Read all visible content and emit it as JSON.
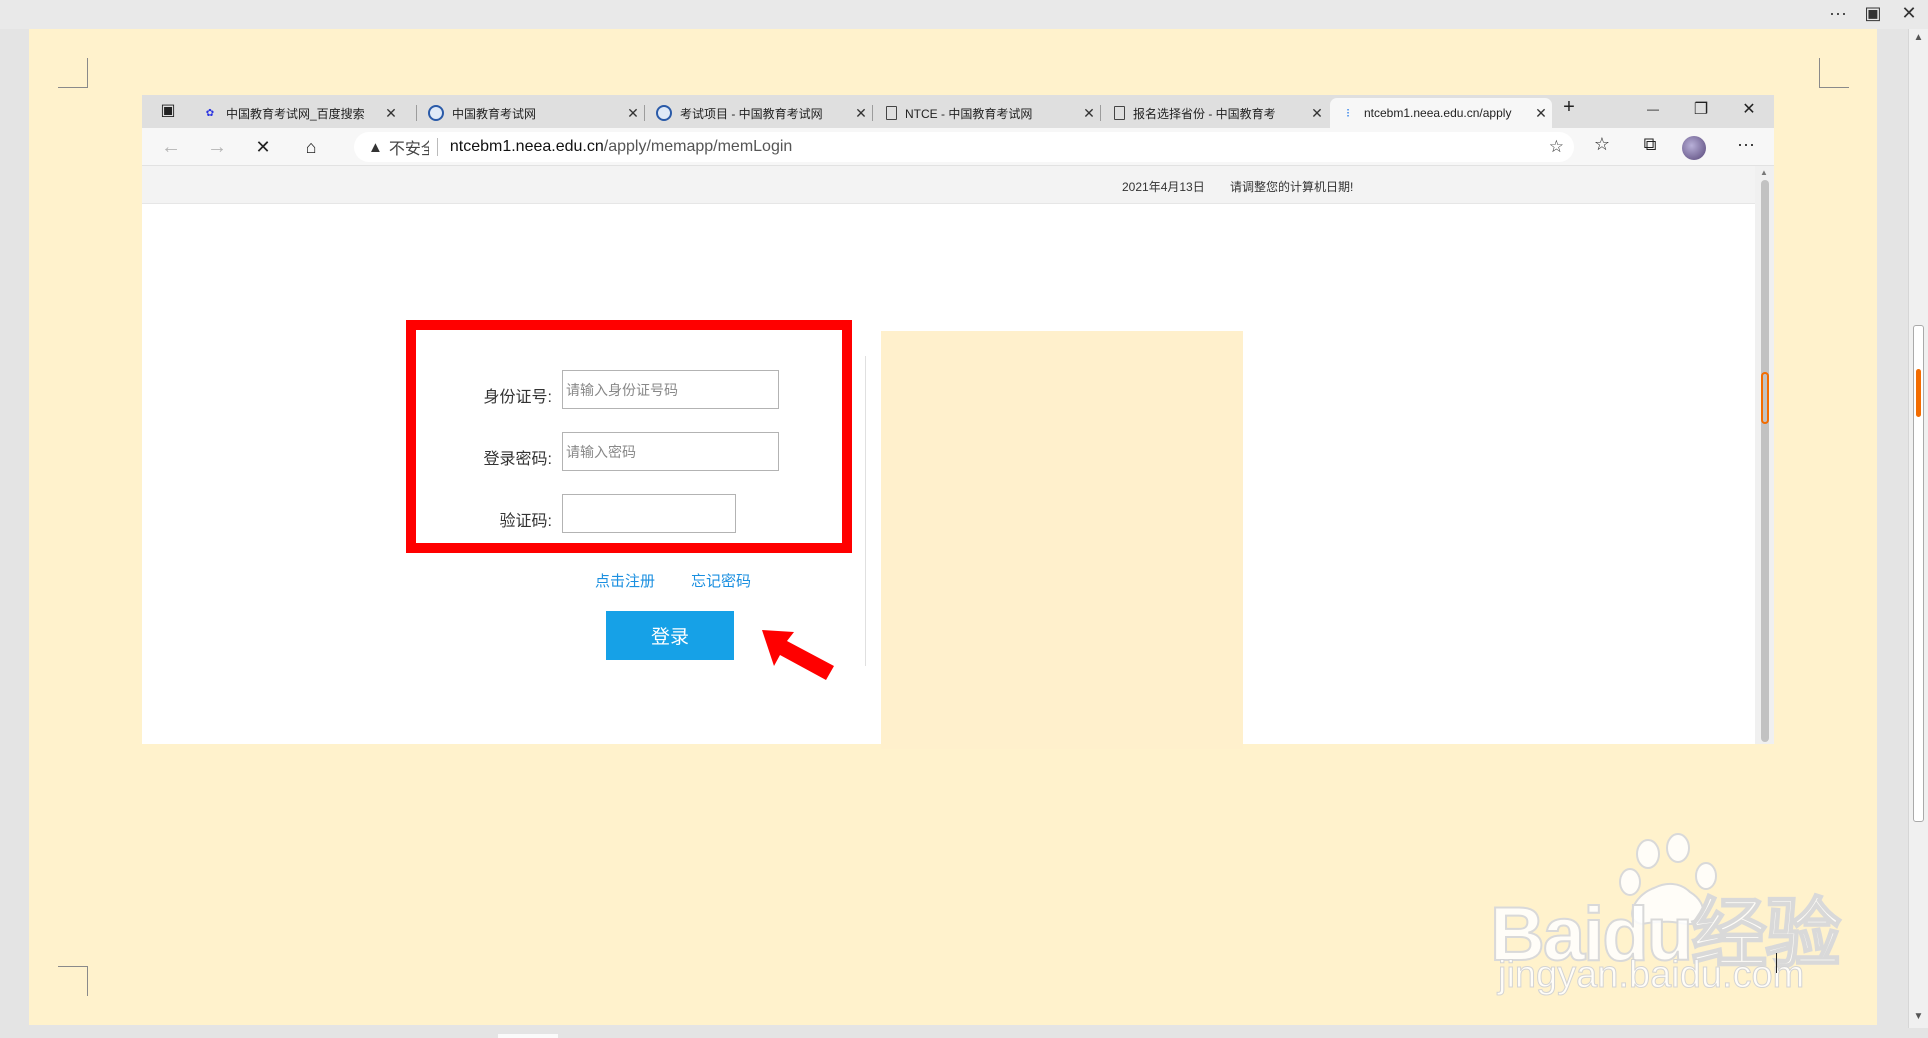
{
  "outer_window": {
    "more_label": "···",
    "restore_label": "▣",
    "close_label": "✕"
  },
  "browser": {
    "tabs": [
      {
        "title": "中国教育考试网_百度搜索",
        "icon": "baidu-paw-icon",
        "active": false
      },
      {
        "title": "中国教育考试网",
        "icon": "neea-globe-icon",
        "active": false
      },
      {
        "title": "考试项目 - 中国教育考试网",
        "icon": "neea-globe-icon",
        "active": false
      },
      {
        "title": "NTCE - 中国教育考试网",
        "icon": "page-icon",
        "active": false
      },
      {
        "title": "报名选择省份 - 中国教育考",
        "icon": "page-icon",
        "active": false
      },
      {
        "title": "ntcebm1.neea.edu.cn/apply",
        "icon": "loading-icon",
        "active": true
      }
    ],
    "tab_close": "✕",
    "new_tab": "+",
    "window_controls": {
      "minimize": "—",
      "maximize": "❐",
      "close": "✕"
    },
    "address": {
      "insecure_label": "不安全",
      "host": "ntcebm1.neea.edu.cn",
      "path": "/apply/memapp/memLogin"
    }
  },
  "page": {
    "date_text": "2021年4月13日",
    "date_notice": "请调整您的计算机日期!",
    "form": {
      "id_label": "身份证号:",
      "id_placeholder": "请输入身份证号码",
      "password_label": "登录密码:",
      "password_placeholder": "请输入密码",
      "captcha_label": "验证码:",
      "captcha_value": ""
    },
    "register_link": "点击注册",
    "forgot_link": "忘记密码",
    "login_button": "登录"
  },
  "annotation": {
    "box_color": "#ff0000",
    "arrow_color": "#ff0000"
  },
  "watermark": {
    "brand": "Baidu经验",
    "url": "jingyan.baidu.com"
  }
}
